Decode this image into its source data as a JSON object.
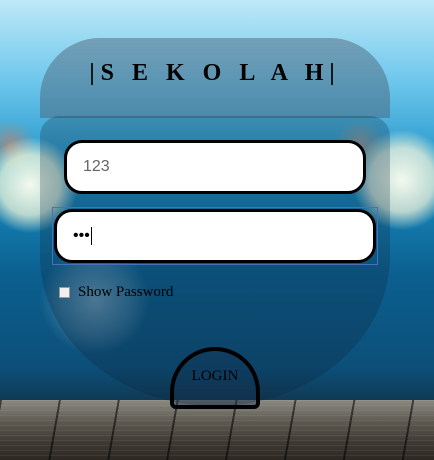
{
  "app": {
    "title": "|S E K O L A H|"
  },
  "form": {
    "username_value": "123",
    "password_value": "•••",
    "show_password_label": "Show Password",
    "show_password_checked": false,
    "login_label": "LOGIN"
  }
}
